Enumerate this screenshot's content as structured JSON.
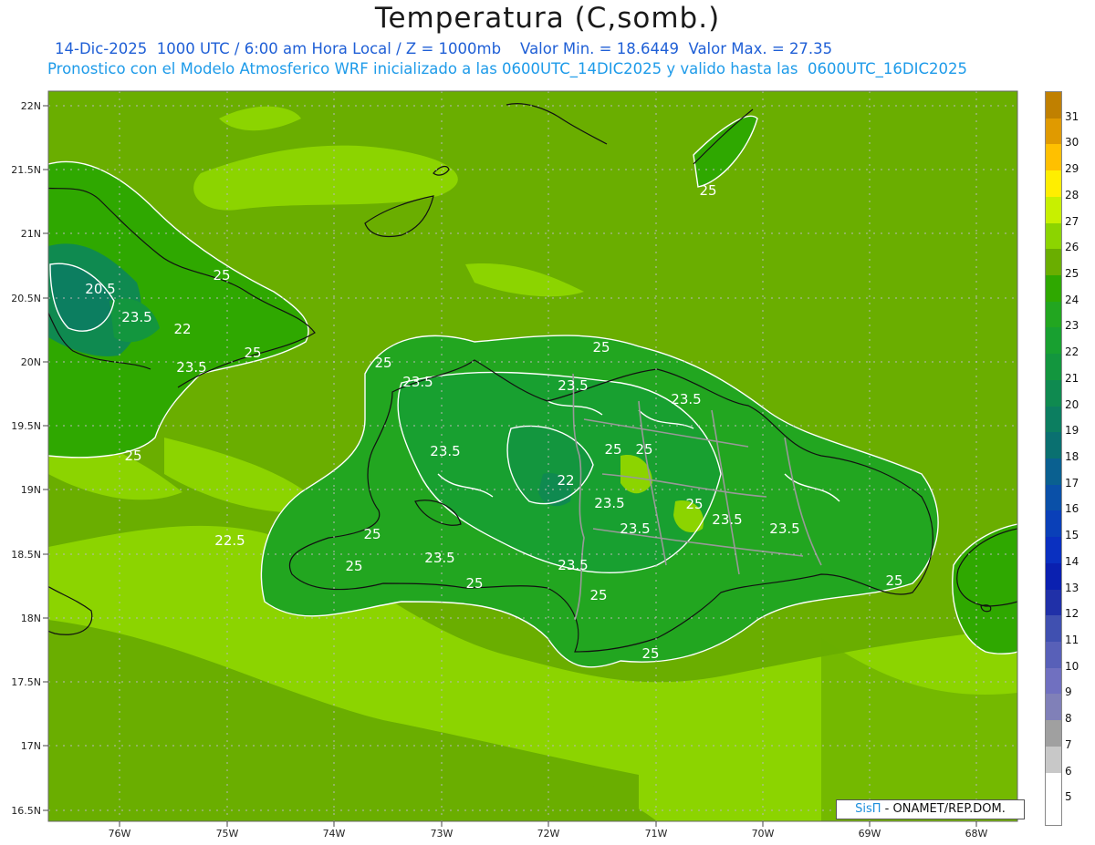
{
  "header": {
    "title": "Temperatura (C,somb.)",
    "line1": "14-Dic-2025  1000 UTC / 6:00 am Hora Local / Z = 1000mb    Valor Min. = 18.6449  Valor Max. = 27.35",
    "line2": "Pronostico con el Modelo Atmosferico WRF inicializado a las 0600UTC_14DIC2025 y valido hasta las  0600UTC_16DIC2025"
  },
  "axes": {
    "lat_labels": [
      "22N",
      "21.5N",
      "21N",
      "20.5N",
      "20N",
      "19.5N",
      "19N",
      "18.5N",
      "18N",
      "17.5N",
      "17N",
      "16.5N"
    ],
    "lon_labels": [
      "76W",
      "75W",
      "74W",
      "73W",
      "72W",
      "71W",
      "70W",
      "69W",
      "68W"
    ]
  },
  "contour_labels": [
    "20.5",
    "23.5",
    "22",
    "25",
    "25",
    "23.5",
    "25",
    "25",
    "25",
    "23.5",
    "23.5",
    "23.5",
    "23.5",
    "25",
    "25",
    "22",
    "23.5",
    "23.5",
    "25",
    "23.5",
    "23.5",
    "22.5",
    "25",
    "25",
    "23.5",
    "25",
    "23.5",
    "25",
    "25",
    "25",
    "25"
  ],
  "colorbar": {
    "labels": [
      "31",
      "30",
      "29",
      "28",
      "27",
      "26",
      "25",
      "24",
      "23",
      "22",
      "21",
      "20",
      "19",
      "18",
      "17",
      "16",
      "15",
      "14",
      "13",
      "12",
      "11",
      "10",
      "9",
      "8",
      "7",
      "6",
      "5"
    ],
    "colors": [
      "#c08000",
      "#e09a00",
      "#ffc000",
      "#ffee00",
      "#c8f000",
      "#8cd400",
      "#6aae00",
      "#2fa800",
      "#22a620",
      "#18a030",
      "#13963e",
      "#0f8a50",
      "#0c7e60",
      "#0a7070",
      "#0a6090",
      "#0a50a8",
      "#0a40b8",
      "#0a30c0",
      "#0a20b0",
      "#2030a8",
      "#4050b0",
      "#5860b8",
      "#7070c0",
      "#8080b8",
      "#a0a0a0",
      "#c8c8c8",
      "#ffffff"
    ]
  },
  "credit": {
    "brand": "SisΠ",
    "text": " - ONAMET/REP.DOM."
  }
}
